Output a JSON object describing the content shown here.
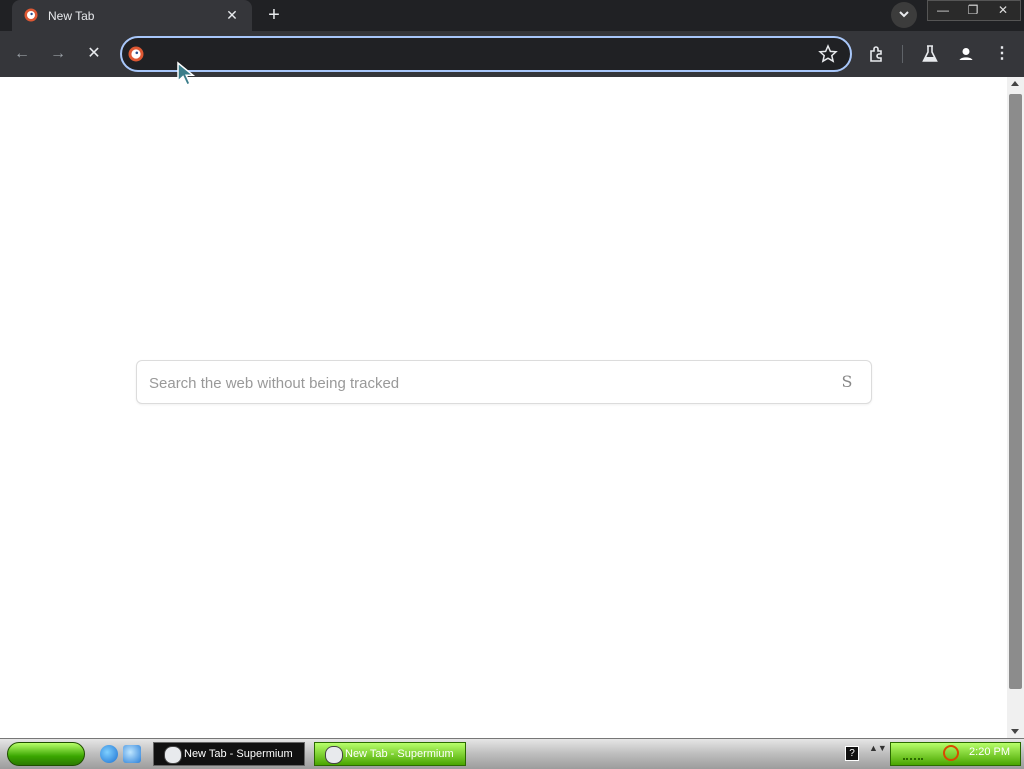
{
  "tab": {
    "title": "New Tab",
    "close_icon": "close-icon"
  },
  "omnibox": {
    "value": "",
    "placeholder": ""
  },
  "page": {
    "search_placeholder": "Search the web without being tracked",
    "search_button_label": "S"
  },
  "taskbar": {
    "tasks": [
      {
        "label": "New Tab - Supermium"
      },
      {
        "label": "New Tab - Supermium"
      }
    ],
    "clock": "2:20 PM",
    "help_label": "?"
  },
  "colors": {
    "titlebar": "#202124",
    "toolbar": "#35363a",
    "omnibox_focus": "#a8c7fa",
    "taskbar_green": "#4aa500"
  }
}
